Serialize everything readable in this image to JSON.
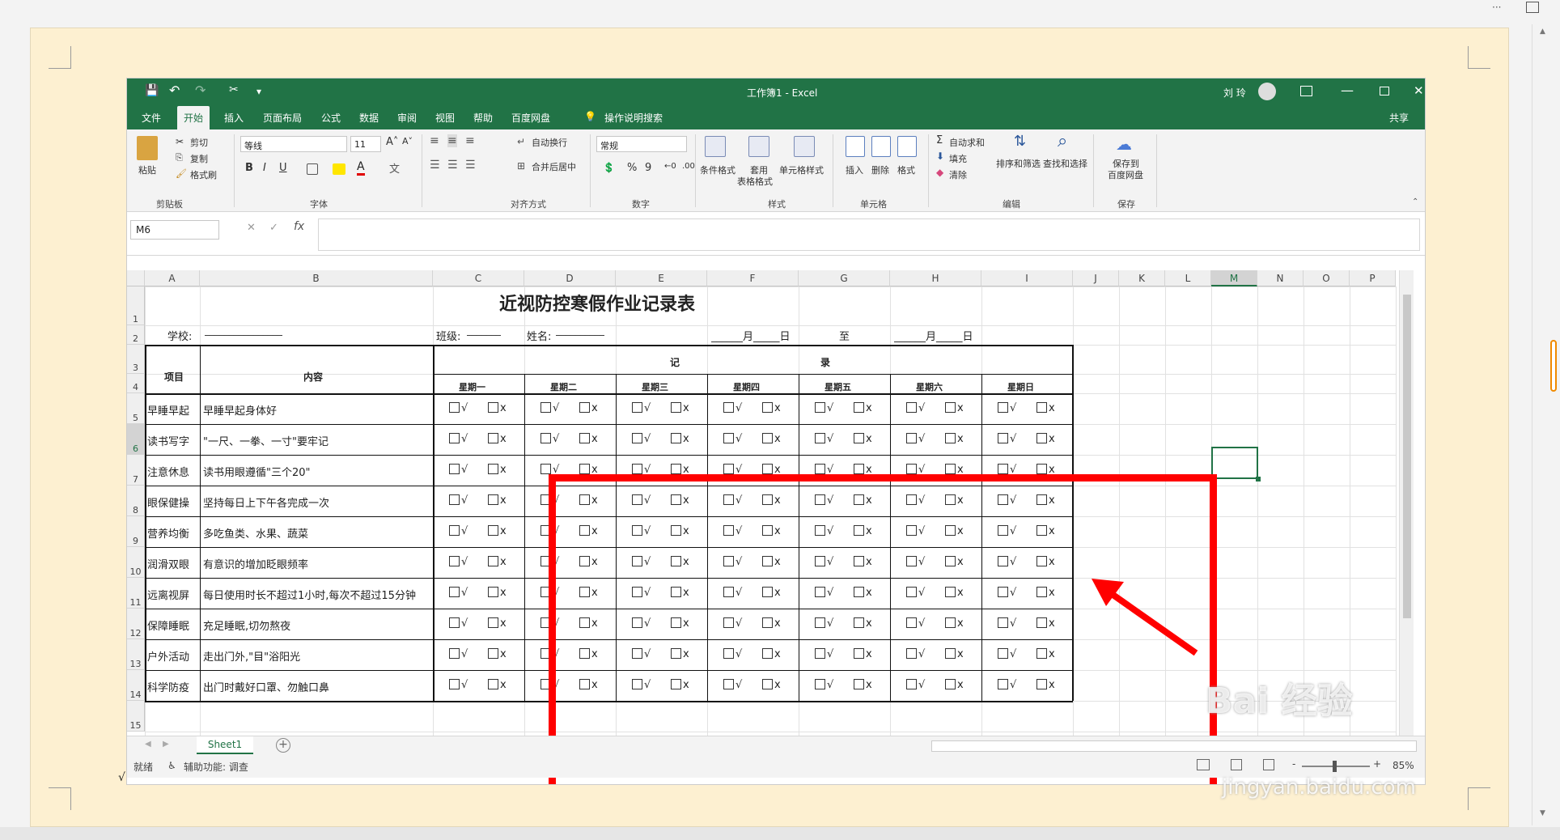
{
  "window": {
    "title": "工作簿1  -  Excel",
    "user": "刘 玲"
  },
  "qat": {
    "more": "▾"
  },
  "menu": [
    "文件",
    "开始",
    "插入",
    "页面布局",
    "公式",
    "数据",
    "审阅",
    "视图",
    "帮助",
    "百度网盘"
  ],
  "menu_search": "操作说明搜索",
  "menu_share": "共享",
  "ribbon": {
    "clipboard": {
      "paste": "粘贴",
      "cut": "剪切",
      "copy": "复制",
      "format_painter": "格式刷",
      "label": "剪贴板"
    },
    "font": {
      "name": "等线",
      "size": "11",
      "bold": "B",
      "italic": "I",
      "underline": "U",
      "grow": "A˄",
      "shrink": "A˅",
      "label": "字体"
    },
    "alignment": {
      "wrap": "自动换行",
      "merge": "合并后居中",
      "label": "对齐方式"
    },
    "number": {
      "format": "常规",
      "percent": "%",
      "comma": "9",
      "label": "数字"
    },
    "styles": {
      "cond": "条件格式",
      "table_fmt_1": "套用",
      "table_fmt_2": "表格格式",
      "cell_style": "单元格样式",
      "label": "样式"
    },
    "cells": {
      "insert": "插入",
      "delete": "删除",
      "format": "格式",
      "label": "单元格"
    },
    "editing": {
      "autosum": "自动求和",
      "fill": "填充",
      "clear": "清除",
      "sort": "排序和筛选",
      "find": "查找和选择",
      "label": "编辑"
    },
    "save": {
      "save_1": "保存到",
      "save_2": "百度网盘",
      "label": "保存"
    }
  },
  "formula_bar": {
    "name_box": "M6",
    "fx": "fx",
    "cancel": "✕",
    "enter": "✓"
  },
  "columns": [
    "A",
    "B",
    "C",
    "D",
    "E",
    "F",
    "G",
    "H",
    "I",
    "J",
    "K",
    "L",
    "M",
    "N",
    "O",
    "P"
  ],
  "rows": [
    "1",
    "2",
    "3",
    "4",
    "5",
    "6",
    "7",
    "8",
    "9",
    "10",
    "11",
    "12",
    "13",
    "14",
    "15"
  ],
  "sheet": {
    "title": "近视防控寒假作业记录表",
    "school": "学校:",
    "school_line": "________________",
    "class": "班级:",
    "class_line": "_______",
    "name": "姓名:",
    "name_line": "__________",
    "date_from": "______月_____日",
    "to": "至",
    "date_to": "______月_____日",
    "hdr_item": "项目",
    "hdr_content": "内容",
    "hdr_ji": "记",
    "hdr_lu": "录",
    "days": [
      "星期一",
      "星期二",
      "星期三",
      "星期四",
      "星期五",
      "星期六",
      "星期日"
    ],
    "check_yes": "√",
    "check_no": "x",
    "items": [
      {
        "item": "早睡早起",
        "content": "早睡早起身体好"
      },
      {
        "item": "读书写字",
        "content": "\"一尺、一拳、一寸\"要牢记"
      },
      {
        "item": "注意休息",
        "content": "读书用眼遵循\"三个20\""
      },
      {
        "item": "眼保健操",
        "content": "坚持每日上下午各完成一次"
      },
      {
        "item": "营养均衡",
        "content": "多吃鱼类、水果、蔬菜"
      },
      {
        "item": "润滑双眼",
        "content": "有意识的增加眨眼频率"
      },
      {
        "item": "远离视屏",
        "content": "每日使用时长不超过1小时,每次不超过15分钟"
      },
      {
        "item": "保障睡眠",
        "content": "充足睡眠,切勿熬夜"
      },
      {
        "item": "户外活动",
        "content": "走出门外,\"目\"浴阳光"
      },
      {
        "item": "科学防疫",
        "content": "出门时戴好口罩、勿触口鼻"
      }
    ]
  },
  "sheet_tabs": {
    "active": "Sheet1",
    "add": "+"
  },
  "status": {
    "ready": "就绪",
    "accessibility": "辅助功能: 调查",
    "zoom": "85%",
    "minus": "-",
    "plus": "+"
  },
  "page_marks": {
    "checkmark": "√"
  },
  "watermark": {
    "brand": "Bai 经验",
    "url": "jingyan.baidu.com"
  },
  "colors": {
    "excel_green": "#217346",
    "highlight_red": "#ff0000",
    "page_bg": "#fdf0d1"
  }
}
